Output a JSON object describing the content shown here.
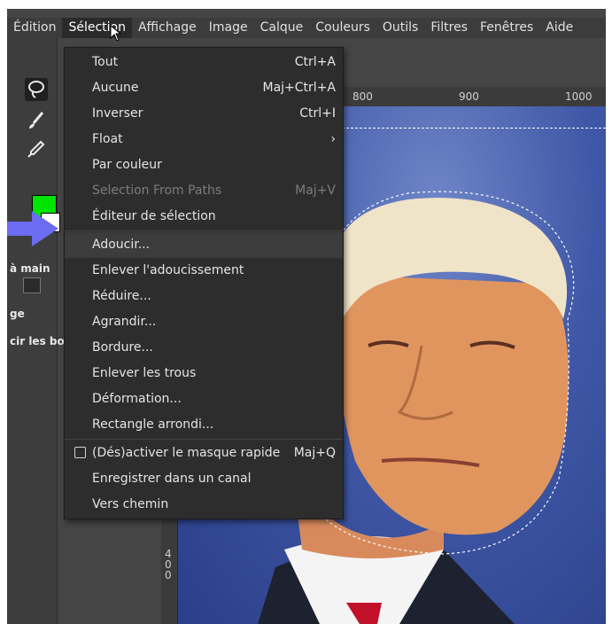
{
  "menubar": {
    "items": [
      "Édition",
      "Sélection",
      "Affichage",
      "Image",
      "Calque",
      "Couleurs",
      "Outils",
      "Filtres",
      "Fenêtres",
      "Aide"
    ],
    "active": "Sélection"
  },
  "toolbox": {
    "fg_color": "#00e400",
    "bg_color": "#ffffff",
    "text_hand": "à main",
    "text_ge": "ge",
    "text_cir": "cir les bo"
  },
  "ruler": {
    "top_labels": [
      "800",
      "900",
      "1000"
    ],
    "left_labels": [
      "4",
      "0",
      "0"
    ]
  },
  "menu": {
    "items": [
      {
        "label": "Tout",
        "shortcut": "Ctrl+A"
      },
      {
        "label": "Aucune",
        "shortcut": "Maj+Ctrl+A"
      },
      {
        "label": "Inverser",
        "shortcut": "Ctrl+I"
      },
      {
        "label": "Float",
        "shortcut": "›"
      },
      {
        "label": "Par couleur",
        "shortcut": ""
      },
      {
        "label": "Selection From Paths",
        "shortcut": "Maj+V",
        "disabled": true
      },
      {
        "label": "Éditeur de sélection",
        "shortcut": ""
      },
      {
        "label": "Adoucir...",
        "shortcut": "",
        "hover": true
      },
      {
        "label": "Enlever l'adoucissement",
        "shortcut": ""
      },
      {
        "label": "Réduire...",
        "shortcut": ""
      },
      {
        "label": "Agrandir...",
        "shortcut": ""
      },
      {
        "label": "Bordure...",
        "shortcut": ""
      },
      {
        "label": "Enlever les trous",
        "shortcut": ""
      },
      {
        "label": "Déformation...",
        "shortcut": ""
      },
      {
        "label": "Rectangle arrondi...",
        "shortcut": ""
      },
      {
        "label": "(Dés)activer le masque rapide",
        "shortcut": "Maj+Q",
        "checkbox": true
      },
      {
        "label": "Enregistrer dans un canal",
        "shortcut": ""
      },
      {
        "label": "Vers chemin",
        "shortcut": ""
      }
    ]
  },
  "colors": {
    "accent_arrow": "#6b6cf2",
    "menu_bg": "#2d2d2d"
  }
}
